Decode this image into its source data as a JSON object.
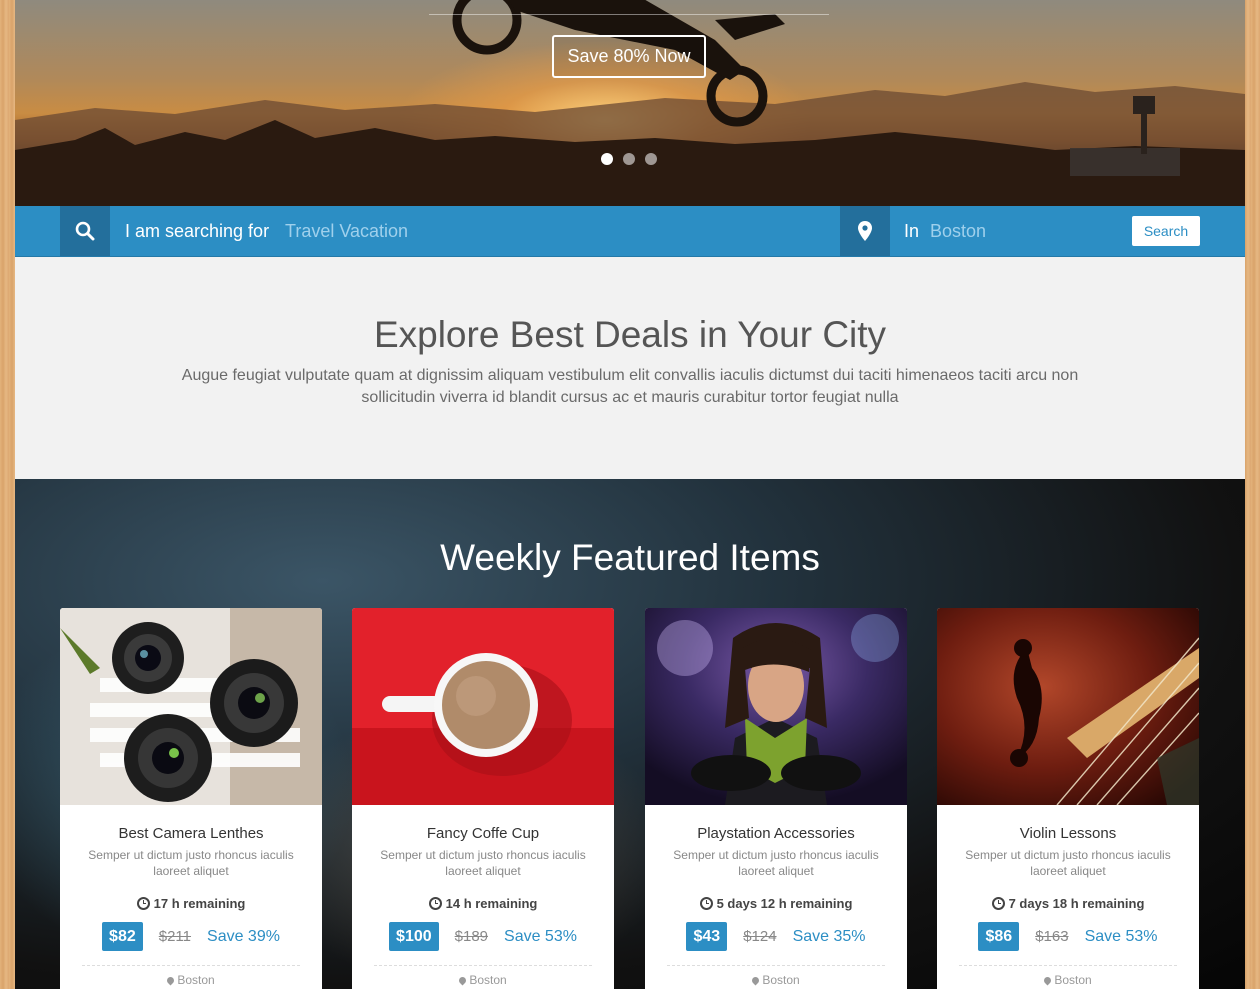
{
  "hero": {
    "cta_label": "Save 80% Now",
    "slides": [
      {
        "active": true
      },
      {
        "active": false
      },
      {
        "active": false
      }
    ]
  },
  "search": {
    "prefix_label": "I am searching for",
    "query_placeholder": "Travel Vacation",
    "location_label": "In",
    "location_placeholder": "Boston",
    "button_label": "Search",
    "search_icon": "search-icon",
    "location_icon": "map-marker-icon"
  },
  "explore": {
    "title": "Explore Best Deals in Your City",
    "description": "Augue feugiat vulputate quam at dignissim aliquam vestibulum elit convallis iaculis dictumst dui taciti himenaeos taciti arcu non sollicitudin viverra id blandit cursus ac et mauris curabitur tortor feugiat nulla"
  },
  "featured": {
    "title": "Weekly Featured Items",
    "items": [
      {
        "title": "Best Camera Lenthes",
        "description": "Semper ut dictum justo rhoncus iaculis laoreet aliquet",
        "remaining": "17 h remaining",
        "price": "$82",
        "old_price": "$211",
        "save": "Save 39%",
        "location": "Boston",
        "image": "camera-lenses"
      },
      {
        "title": "Fancy Coffe Cup",
        "description": "Semper ut dictum justo rhoncus iaculis laoreet aliquet",
        "remaining": "14 h remaining",
        "price": "$100",
        "old_price": "$189",
        "save": "Save 53%",
        "location": "Boston",
        "image": "coffee-cup"
      },
      {
        "title": "Playstation Accessories",
        "description": "Semper ut dictum justo rhoncus iaculis laoreet aliquet",
        "remaining": "5 days 12 h remaining",
        "price": "$43",
        "old_price": "$124",
        "save": "Save 35%",
        "location": "Boston",
        "image": "girl-with-controllers"
      },
      {
        "title": "Violin Lessons",
        "description": "Semper ut dictum justo rhoncus iaculis laoreet aliquet",
        "remaining": "7 days 18 h remaining",
        "price": "$86",
        "old_price": "$163",
        "save": "Save 53%",
        "location": "Boston",
        "image": "violin"
      }
    ]
  },
  "colors": {
    "accent": "#2c8ec4",
    "accent_dark": "#236f9c"
  }
}
